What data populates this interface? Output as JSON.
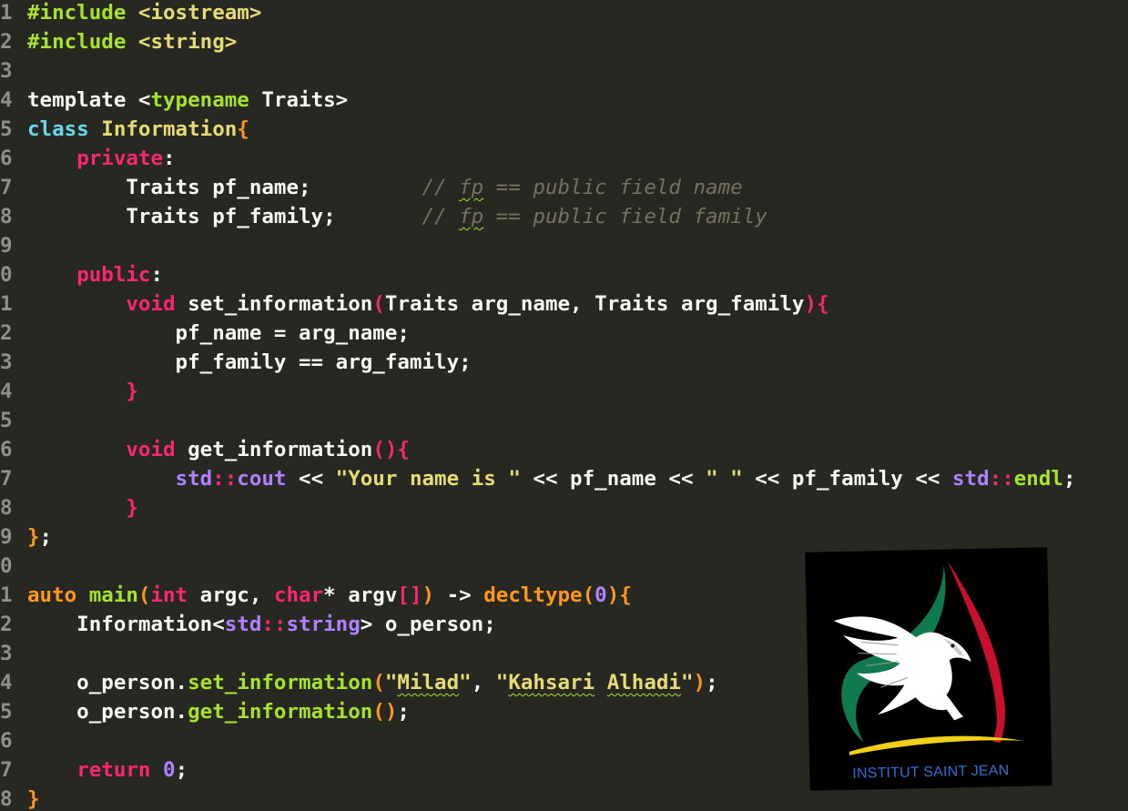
{
  "editor": {
    "gutter_numbers": [
      "1",
      "2",
      "3",
      "4",
      "5",
      "6",
      "7",
      "8",
      "9",
      "0",
      "1",
      "2",
      "3",
      "4",
      "5",
      "6",
      "7",
      "8",
      "9",
      "0",
      "1",
      "2",
      "3",
      "4",
      "5",
      "6",
      "7",
      "8"
    ],
    "lines": [
      [
        {
          "t": "#include ",
          "c": "pp"
        },
        {
          "t": "<iostream>",
          "c": "str"
        }
      ],
      [
        {
          "t": "#include ",
          "c": "pp"
        },
        {
          "t": "<string>",
          "c": "str"
        }
      ],
      [],
      [
        {
          "t": "template ",
          "c": "kw"
        },
        {
          "t": "<",
          "c": "kw"
        },
        {
          "t": "typename",
          "c": "type-green"
        },
        {
          "t": " Traits>",
          "c": "kw"
        }
      ],
      [
        {
          "t": "class ",
          "c": "kw-blue"
        },
        {
          "t": "Information",
          "c": "cls"
        },
        {
          "t": "{",
          "c": "br"
        }
      ],
      [
        {
          "t": "    "
        },
        {
          "t": "private",
          "c": "kw-red"
        },
        {
          "t": ":",
          "c": "kw"
        }
      ],
      [
        {
          "t": "        Traits pf_name;         ",
          "c": "kw"
        },
        {
          "t": "// ",
          "c": "cm"
        },
        {
          "t": "fp",
          "c": "cm squig-c"
        },
        {
          "t": " == public field name",
          "c": "cm"
        }
      ],
      [
        {
          "t": "        Traits pf_family;       ",
          "c": "kw"
        },
        {
          "t": "// ",
          "c": "cm"
        },
        {
          "t": "fp",
          "c": "cm squig-c"
        },
        {
          "t": " == public field family",
          "c": "cm"
        }
      ],
      [],
      [
        {
          "t": "    "
        },
        {
          "t": "public",
          "c": "kw-red"
        },
        {
          "t": ":",
          "c": "kw"
        }
      ],
      [
        {
          "t": "        "
        },
        {
          "t": "void",
          "c": "kw-red"
        },
        {
          "t": " set_information",
          "c": "kw"
        },
        {
          "t": "(",
          "c": "br-red"
        },
        {
          "t": "Traits arg_name, Traits arg_family",
          "c": "kw"
        },
        {
          "t": ")",
          "c": "br-red"
        },
        {
          "t": "{",
          "c": "br-red"
        }
      ],
      [
        {
          "t": "            pf_name = arg_name;",
          "c": "kw"
        }
      ],
      [
        {
          "t": "            pf_family == arg_family;",
          "c": "kw"
        }
      ],
      [
        {
          "t": "        "
        },
        {
          "t": "}",
          "c": "br-red"
        }
      ],
      [],
      [
        {
          "t": "        "
        },
        {
          "t": "void",
          "c": "kw-red"
        },
        {
          "t": " get_information",
          "c": "kw"
        },
        {
          "t": "()",
          "c": "br-red"
        },
        {
          "t": "{",
          "c": "br-red"
        }
      ],
      [
        {
          "t": "            "
        },
        {
          "t": "std",
          "c": "ns"
        },
        {
          "t": "::",
          "c": "kw-red"
        },
        {
          "t": "cout",
          "c": "ns"
        },
        {
          "t": " << ",
          "c": "kw"
        },
        {
          "t": "\"Your name is \"",
          "c": "str"
        },
        {
          "t": " << pf_name << ",
          "c": "kw"
        },
        {
          "t": "\" \"",
          "c": "str"
        },
        {
          "t": " << pf_family << ",
          "c": "kw"
        },
        {
          "t": "std",
          "c": "ns"
        },
        {
          "t": "::",
          "c": "kw-red"
        },
        {
          "t": "endl",
          "c": "fn"
        },
        {
          "t": ";",
          "c": "kw"
        }
      ],
      [
        {
          "t": "        "
        },
        {
          "t": "}",
          "c": "br-red"
        }
      ],
      [
        {
          "t": "}",
          "c": "br"
        },
        {
          "t": ";",
          "c": "kw"
        }
      ],
      [],
      [
        {
          "t": "auto ",
          "c": "kw-orange"
        },
        {
          "t": "main",
          "c": "fn"
        },
        {
          "t": "(",
          "c": "br"
        },
        {
          "t": "int",
          "c": "kw-red"
        },
        {
          "t": " argc, ",
          "c": "kw"
        },
        {
          "t": "char",
          "c": "kw-red"
        },
        {
          "t": "* argv",
          "c": "kw"
        },
        {
          "t": "[]",
          "c": "br-red"
        },
        {
          "t": ")",
          "c": "br"
        },
        {
          "t": " -> ",
          "c": "kw"
        },
        {
          "t": "decltype",
          "c": "kw-orange"
        },
        {
          "t": "(",
          "c": "br"
        },
        {
          "t": "0",
          "c": "num"
        },
        {
          "t": ")",
          "c": "br"
        },
        {
          "t": "{",
          "c": "br"
        }
      ],
      [
        {
          "t": "    Information<",
          "c": "kw"
        },
        {
          "t": "std",
          "c": "ns"
        },
        {
          "t": "::",
          "c": "kw-red"
        },
        {
          "t": "string",
          "c": "ns"
        },
        {
          "t": "> o_person;",
          "c": "kw"
        }
      ],
      [],
      [
        {
          "t": "    o_person.",
          "c": "kw"
        },
        {
          "t": "set_information",
          "c": "fn"
        },
        {
          "t": "(",
          "c": "br"
        },
        {
          "t": "\"",
          "c": "str"
        },
        {
          "t": "Milad",
          "c": "str squig"
        },
        {
          "t": "\"",
          "c": "str"
        },
        {
          "t": ", ",
          "c": "kw"
        },
        {
          "t": "\"",
          "c": "str"
        },
        {
          "t": "Kahsari",
          "c": "str squig"
        },
        {
          "t": " ",
          "c": "str"
        },
        {
          "t": "Alhadi",
          "c": "str squig"
        },
        {
          "t": "\"",
          "c": "str"
        },
        {
          "t": ")",
          "c": "br"
        },
        {
          "t": ";",
          "c": "kw"
        }
      ],
      [
        {
          "t": "    o_person.",
          "c": "kw"
        },
        {
          "t": "get_information",
          "c": "fn"
        },
        {
          "t": "()",
          "c": "br"
        },
        {
          "t": ";",
          "c": "kw"
        }
      ],
      [],
      [
        {
          "t": "    "
        },
        {
          "t": "return",
          "c": "kw-red"
        },
        {
          "t": " "
        },
        {
          "t": "0",
          "c": "num"
        },
        {
          "t": ";",
          "c": "kw"
        }
      ],
      [
        {
          "t": "}",
          "c": "br"
        }
      ]
    ]
  },
  "logo": {
    "text": "INSTITUT SAINT JEAN",
    "colors": {
      "green": "#0e7a4e",
      "red": "#c8102e",
      "yellow": "#f2d019",
      "blue": "#2f6fd1"
    },
    "icon": "eagle-icon"
  }
}
